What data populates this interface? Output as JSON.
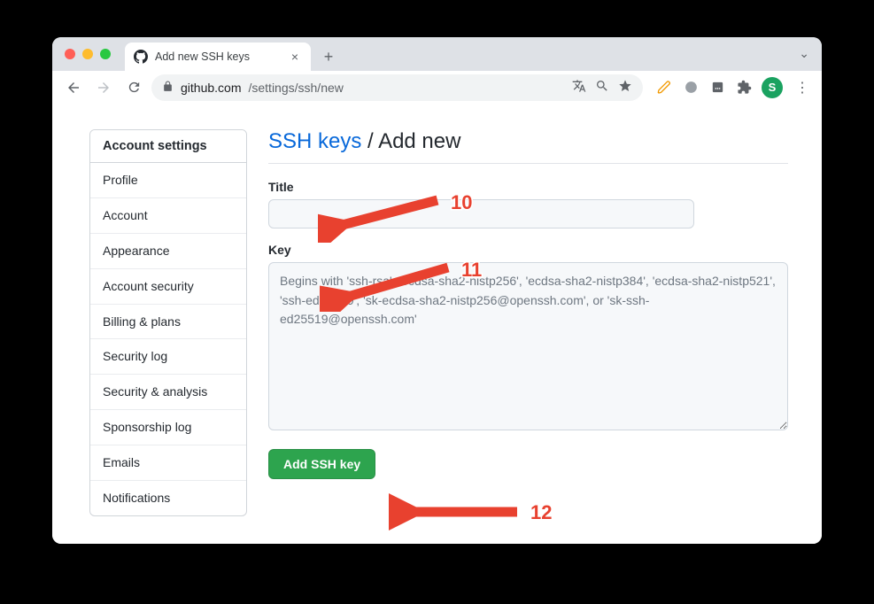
{
  "chrome": {
    "tab_title": "Add new SSH keys",
    "new_tab_glyph": "+",
    "chevron_glyph": "⌄",
    "url_host": "github.com",
    "url_path": "/settings/ssh/new",
    "avatar_letter": "S"
  },
  "sidebar": {
    "heading": "Account settings",
    "items": [
      {
        "label": "Profile"
      },
      {
        "label": "Account"
      },
      {
        "label": "Appearance"
      },
      {
        "label": "Account security"
      },
      {
        "label": "Billing & plans"
      },
      {
        "label": "Security log"
      },
      {
        "label": "Security & analysis"
      },
      {
        "label": "Sponsorship log"
      },
      {
        "label": "Emails"
      },
      {
        "label": "Notifications"
      }
    ]
  },
  "breadcrumb": {
    "link": "SSH keys",
    "sep": " / ",
    "current": "Add new"
  },
  "form": {
    "title_label": "Title",
    "title_value": "",
    "key_label": "Key",
    "key_value": "",
    "key_placeholder": "Begins with 'ssh-rsa', 'ecdsa-sha2-nistp256', 'ecdsa-sha2-nistp384', 'ecdsa-sha2-nistp521', 'ssh-ed25519', 'sk-ecdsa-sha2-nistp256@openssh.com', or 'sk-ssh-ed25519@openssh.com'",
    "submit_label": "Add SSH key"
  },
  "annotations": {
    "a10": "10",
    "a11": "11",
    "a12": "12"
  }
}
